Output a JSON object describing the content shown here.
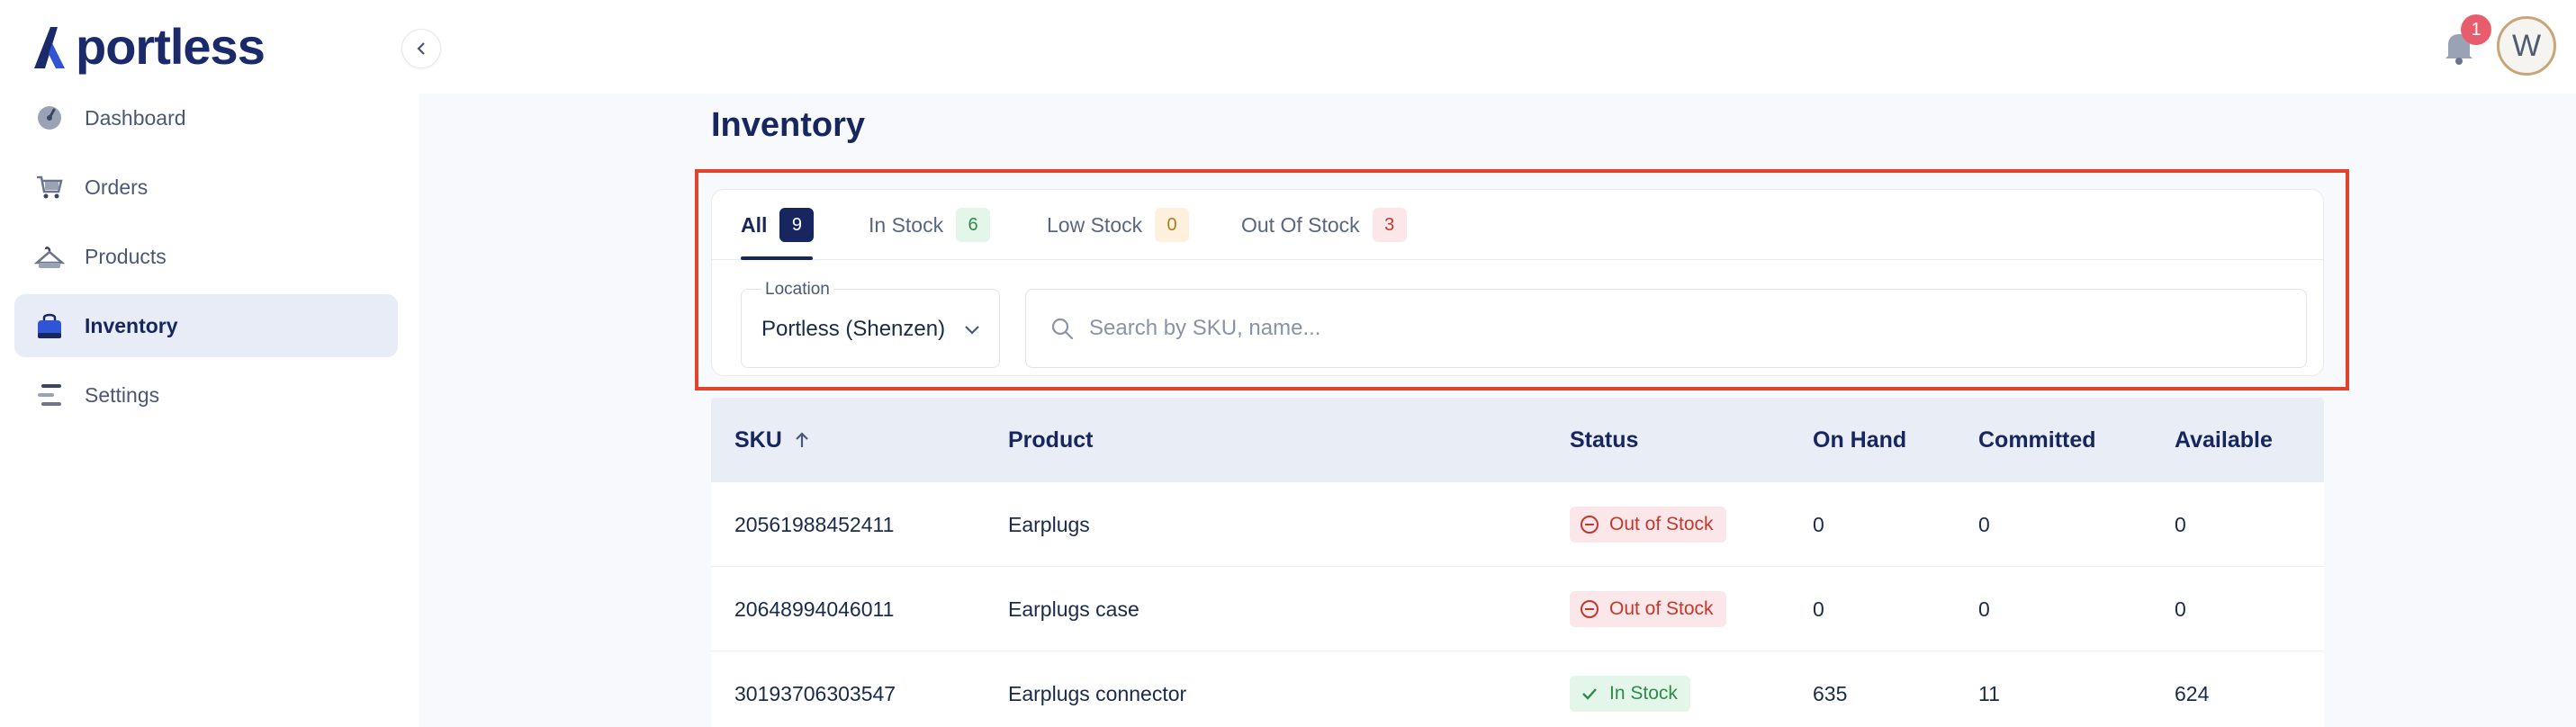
{
  "brand": {
    "name": "portless"
  },
  "sidebar": {
    "items": [
      {
        "label": "Dashboard",
        "icon": "dashboard-icon",
        "active": false
      },
      {
        "label": "Orders",
        "icon": "cart-icon",
        "active": false
      },
      {
        "label": "Products",
        "icon": "hanger-icon",
        "active": false
      },
      {
        "label": "Inventory",
        "icon": "bag-icon",
        "active": true
      },
      {
        "label": "Settings",
        "icon": "settings-lines-icon",
        "active": false
      }
    ]
  },
  "header": {
    "notifications_count": "1",
    "avatar_initial": "W"
  },
  "page": {
    "title": "Inventory"
  },
  "tabs": [
    {
      "label": "All",
      "count": "9",
      "active": true
    },
    {
      "label": "In Stock",
      "count": "6"
    },
    {
      "label": "Low Stock",
      "count": "0"
    },
    {
      "label": "Out Of Stock",
      "count": "3"
    }
  ],
  "filters": {
    "location_label": "Location",
    "location_value": "Portless (Shenzen)",
    "search_placeholder": "Search by SKU, name..."
  },
  "table": {
    "columns": [
      "SKU",
      "Product",
      "Status",
      "On Hand",
      "Committed",
      "Available"
    ],
    "rows": [
      {
        "sku": "20561988452411",
        "product": "Earplugs",
        "status": "Out of Stock",
        "on_hand": "0",
        "committed": "0",
        "available": "0"
      },
      {
        "sku": "20648994046011",
        "product": "Earplugs case",
        "status": "Out of Stock",
        "on_hand": "0",
        "committed": "0",
        "available": "0"
      },
      {
        "sku": "30193706303547",
        "product": "Earplugs connector",
        "status": "In Stock",
        "on_hand": "635",
        "committed": "11",
        "available": "624"
      }
    ]
  },
  "colors": {
    "primary": "#17265e",
    "highlight": "#e1442b",
    "out_of_stock": "#c0392b",
    "in_stock": "#2e8b4a"
  }
}
